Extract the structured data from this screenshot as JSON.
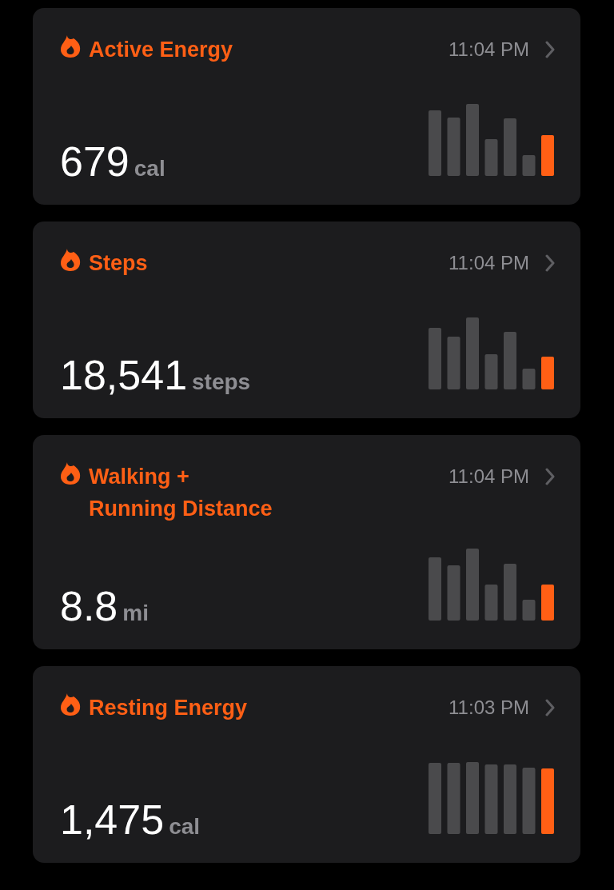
{
  "cards": [
    {
      "title_lines": [
        "Active Energy"
      ],
      "time": "11:04 PM",
      "value": "679",
      "unit": "cal"
    },
    {
      "title_lines": [
        "Steps"
      ],
      "time": "11:04 PM",
      "value": "18,541",
      "unit": "steps"
    },
    {
      "title_lines": [
        "Walking +",
        "Running Distance"
      ],
      "time": "11:04 PM",
      "value": "8.8",
      "unit": "mi"
    },
    {
      "title_lines": [
        "Resting Energy"
      ],
      "time": "11:03 PM",
      "value": "1,475",
      "unit": "cal"
    }
  ]
}
